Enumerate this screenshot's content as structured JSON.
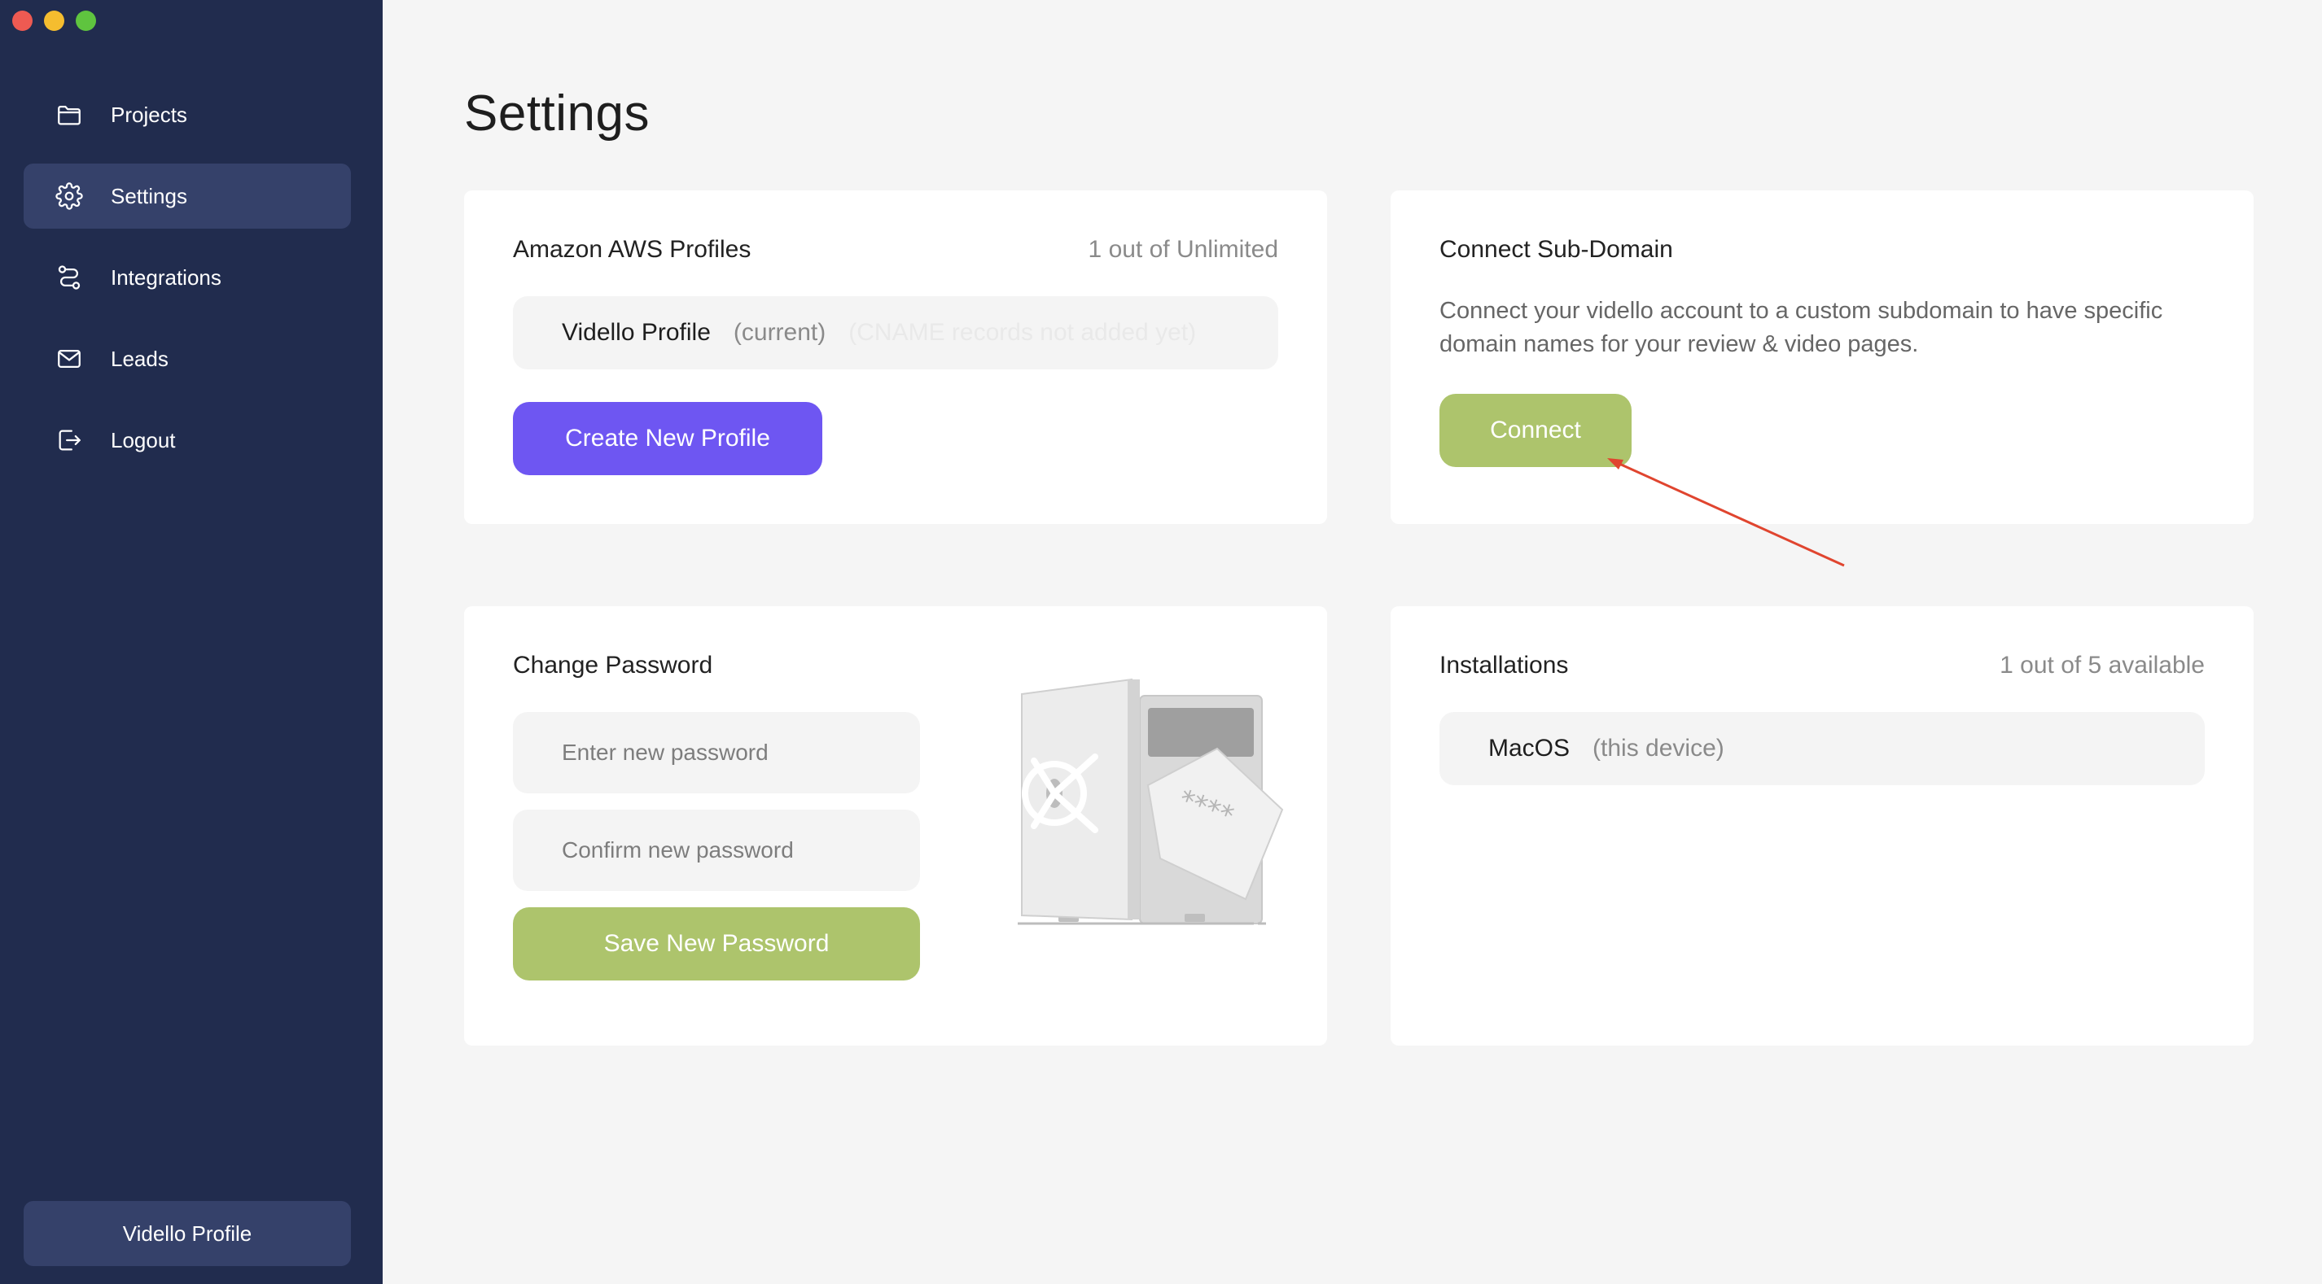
{
  "sidebar": {
    "items": [
      {
        "label": "Projects",
        "icon": "folder-icon",
        "active": false
      },
      {
        "label": "Settings",
        "icon": "gear-icon",
        "active": true
      },
      {
        "label": "Integrations",
        "icon": "route-icon",
        "active": false
      },
      {
        "label": "Leads",
        "icon": "mail-icon",
        "active": false
      },
      {
        "label": "Logout",
        "icon": "logout-icon",
        "active": false
      }
    ],
    "profile_label": "Vidello Profile"
  },
  "page": {
    "title": "Settings"
  },
  "aws": {
    "title": "Amazon AWS Profiles",
    "meta": "1 out of Unlimited",
    "profile_name": "Vidello Profile",
    "profile_tag": "(current)",
    "profile_note": "(CNAME records not added yet)",
    "create_label": "Create New Profile"
  },
  "subdomain": {
    "title": "Connect Sub-Domain",
    "description": "Connect your vidello account to a custom subdomain to have specific domain names for your review & video pages.",
    "connect_label": "Connect"
  },
  "password": {
    "title": "Change Password",
    "new_placeholder": "Enter new password",
    "confirm_placeholder": "Confirm new password",
    "save_label": "Save New Password",
    "illustration_icon": "safe-illustration"
  },
  "installations": {
    "title": "Installations",
    "meta": "1 out of 5 available",
    "device_name": "MacOS",
    "device_tag": "(this device)"
  },
  "colors": {
    "sidebar_bg": "#212c4e",
    "sidebar_active": "#35416a",
    "primary_purple": "#6e56f2",
    "accent_green": "#adc46c",
    "annotation_red": "#e0452f"
  }
}
